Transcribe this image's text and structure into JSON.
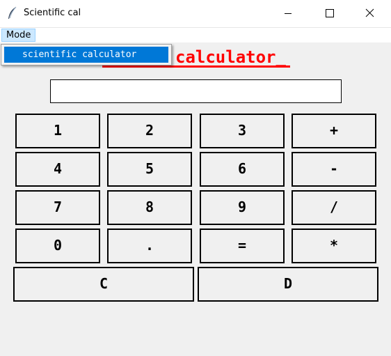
{
  "window": {
    "title": "Scientific cal"
  },
  "menu": {
    "mode_label": "Mode",
    "dropdown_items": [
      "scientific calculator"
    ]
  },
  "app": {
    "heading_visible": "calculator_",
    "display_value": ""
  },
  "keys": {
    "row1": [
      "1",
      "2",
      "3",
      "+"
    ],
    "row2": [
      "4",
      "5",
      "6",
      "-"
    ],
    "row3": [
      "7",
      "8",
      "9",
      "/"
    ],
    "row4": [
      "0",
      ".",
      "=",
      "*"
    ],
    "row5": [
      "C",
      "D"
    ]
  },
  "colors": {
    "heading": "#ff0000",
    "menu_highlight": "#0078d7",
    "menu_active": "#cce8ff",
    "background": "#f0f0f0"
  },
  "icons": [
    "feather-icon",
    "minimize-icon",
    "maximize-icon",
    "close-icon"
  ]
}
